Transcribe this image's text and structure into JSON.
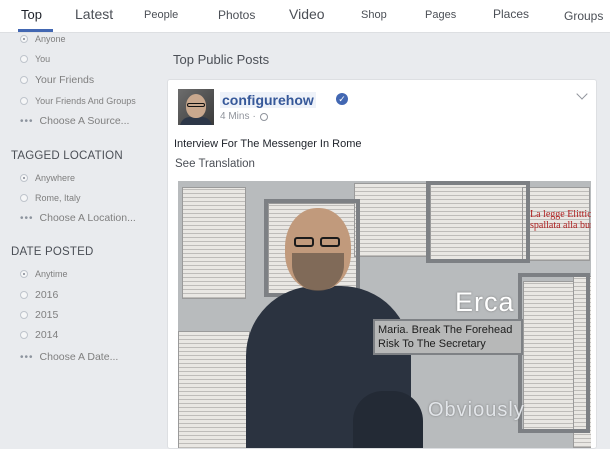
{
  "tabs": [
    "Top",
    "Latest",
    "People",
    "Photos",
    "Video",
    "Shop",
    "Pages",
    "Places",
    "Groups"
  ],
  "active_tab": "Top",
  "filters": {
    "posted_by": {
      "options": [
        "Anyone",
        "You",
        "Your Friends",
        "Your Friends And Groups"
      ],
      "selected": "Anyone",
      "more": "Choose A Source..."
    },
    "tagged_location": {
      "title": "TAGGED LOCATION",
      "options": [
        "Anywhere",
        "Rome, Italy"
      ],
      "selected": "Anywhere",
      "more": "Choose A Location..."
    },
    "date_posted": {
      "title": "DATE POSTED",
      "options": [
        "Anytime",
        "2016",
        "2015",
        "2014"
      ],
      "selected": "Anytime",
      "more": "Choose A Date..."
    }
  },
  "main": {
    "heading": "Top Public Posts"
  },
  "post": {
    "author": "configurehow",
    "verified_icon": "verified-badge-icon",
    "time": "4 Mins",
    "privacy_icon": "globe-icon",
    "text": "Interview For The Messenger In Rome",
    "translate": "See Translation",
    "image_overlays": {
      "big": "Erca",
      "caption_line1": "Maria. Break The Forehead",
      "caption_line2": "Risk To The Secretary",
      "bottom": "Obviously",
      "headline": "La legge Elittica e le\nspallata alla burocra"
    }
  },
  "colors": {
    "accent": "#4267b2",
    "link": "#365899",
    "background": "#e9ebee"
  }
}
